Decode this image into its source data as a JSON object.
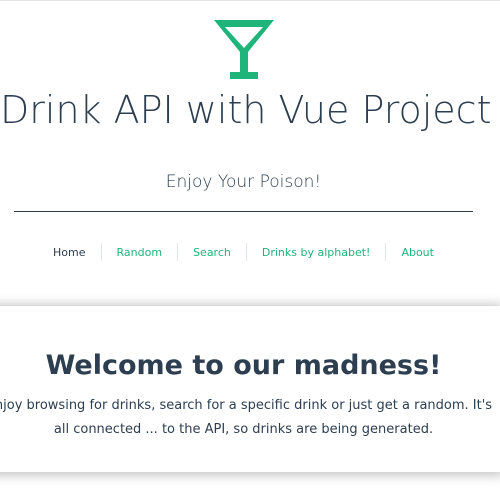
{
  "colors": {
    "accent": "#1fb57a",
    "text": "#2c3e50"
  },
  "header": {
    "logo_icon": "cocktail-glass-icon",
    "title": "Drink API with Vue Project",
    "subtitle": "Enjoy Your Poison!"
  },
  "nav": {
    "items": [
      {
        "label": "Home",
        "active": true
      },
      {
        "label": "Random",
        "active": false
      },
      {
        "label": "Search",
        "active": false
      },
      {
        "label": "Drinks by alphabet!",
        "active": false
      },
      {
        "label": "About",
        "active": false
      }
    ]
  },
  "main": {
    "heading": "Welcome to our madness!",
    "text": "njoy browsing for drinks, search for a specific drink or just get a random. It's all connected ... to the API, so drinks are being generated."
  }
}
